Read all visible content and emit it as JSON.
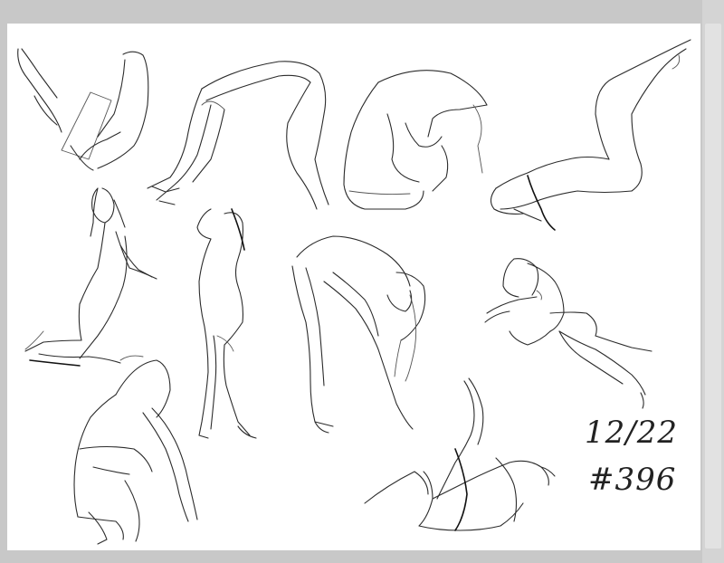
{
  "sheet": {
    "date": "12/22",
    "number": "#396"
  },
  "colors": {
    "background": "#c8c8c8",
    "paper": "#ffffff",
    "ink": "#2b2b2b"
  }
}
